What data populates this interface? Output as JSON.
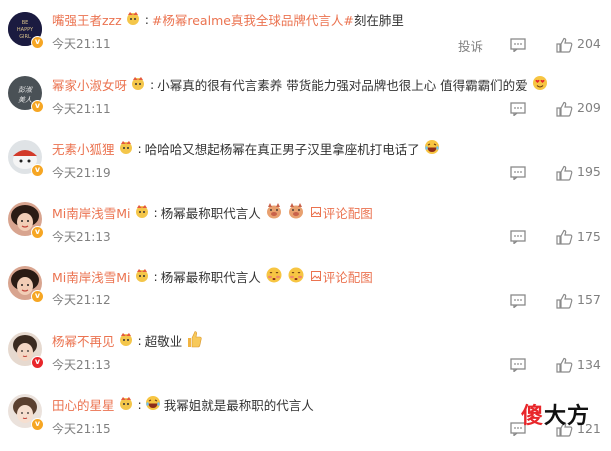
{
  "colors": {
    "username": "#eb7350",
    "topic": "#eb7350",
    "meta": "#808080",
    "text": "#333333",
    "badge": "#f6a623",
    "watermark_red": "#e8262a",
    "watermark_black": "#111111"
  },
  "actions": {
    "report_label": "投诉",
    "reply_icon": "comment-icon",
    "like_icon": "thumbs-up-icon"
  },
  "comments": [
    {
      "username": "嘴强王者zzz",
      "separator": ":",
      "text_before": "",
      "topic": "#杨幂realme真我全球品牌代言人#",
      "text": " 刻在肺里",
      "time": "今天21:11",
      "likes": "204",
      "emojis": [],
      "image_link": ""
    },
    {
      "username": "幂家小淑女呀",
      "separator": ":",
      "text_before": "",
      "topic": "",
      "text": "小幂真的很有代言素养 带货能力强对品牌也很上心 值得霸霸们的爱",
      "time": "今天21:11",
      "likes": "209",
      "emojis": [
        "heart-eyes-emoji"
      ],
      "image_link": ""
    },
    {
      "username": "无素小狐狸",
      "separator": ":",
      "text_before": "",
      "topic": "",
      "text": "哈哈哈又想起杨幂在真正男子汉里拿座机打电话了",
      "time": "今天21:19",
      "likes": "195",
      "emojis": [
        "laughing-emoji"
      ],
      "image_link": ""
    },
    {
      "username": "Mi南岸浅雪Mi",
      "separator": ":",
      "text_before": "",
      "topic": "",
      "text": "杨幂最称职代言人",
      "time": "今天21:13",
      "likes": "175",
      "emojis": [
        "pig-emoji",
        "pig-emoji"
      ],
      "image_link": "评论配图"
    },
    {
      "username": "Mi南岸浅雪Mi",
      "separator": ":",
      "text_before": "",
      "topic": "",
      "text": "杨幂最称职代言人",
      "time": "今天21:12",
      "likes": "157",
      "emojis": [
        "shy-emoji",
        "shy-emoji"
      ],
      "image_link": "评论配图"
    },
    {
      "username": "杨幂不再见",
      "separator": ":",
      "text_before": "",
      "topic": "",
      "text": "超敬业",
      "time": "今天21:13",
      "likes": "134",
      "emojis": [
        "thumbs-up-emoji"
      ],
      "image_link": ""
    },
    {
      "username": "田心的星星",
      "separator": ":",
      "text_before": "",
      "topic": "",
      "text": "我幂姐就是最称职的代言人",
      "time": "今天21:15",
      "likes": "121",
      "emojis": [
        "laughing-emoji"
      ],
      "image_link": ""
    }
  ],
  "watermark": {
    "char1": "傻",
    "char2": "大方"
  }
}
